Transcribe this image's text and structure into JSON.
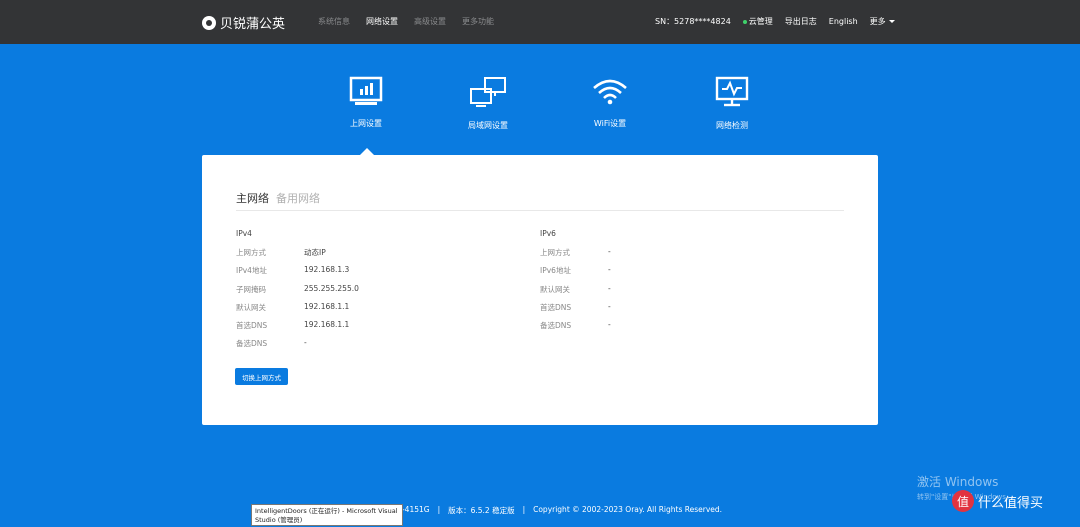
{
  "brand": {
    "name": "贝锐蒲公英"
  },
  "nav": {
    "items": [
      "系统信息",
      "网络设置",
      "高级设置",
      "更多功能"
    ],
    "active_index": 1
  },
  "header_right": {
    "sn": "SN：5278****4824",
    "cloud": "云管理",
    "export_log": "导出日志",
    "language": "English",
    "more": "更多"
  },
  "features": [
    {
      "label": "上网设置",
      "icon": "monitor-chart-icon"
    },
    {
      "label": "局域网设置",
      "icon": "network-computers-icon"
    },
    {
      "label": "WiFi设置",
      "icon": "wifi-icon"
    },
    {
      "label": "网络检测",
      "icon": "monitor-pulse-icon"
    }
  ],
  "tabs": {
    "main": "主网络",
    "backup": "备用网络"
  },
  "ipv4": {
    "title": "IPv4",
    "rows": [
      {
        "k": "上网方式",
        "v": "动态IP"
      },
      {
        "k": "IPv4地址",
        "v": "192.168.1.3"
      },
      {
        "k": "子网掩码",
        "v": "255.255.255.0"
      },
      {
        "k": "默认网关",
        "v": "192.168.1.1"
      },
      {
        "k": "首选DNS",
        "v": "192.168.1.1"
      },
      {
        "k": "备选DNS",
        "v": "-"
      }
    ]
  },
  "ipv6": {
    "title": "IPv6",
    "rows": [
      {
        "k": "上网方式",
        "v": "-"
      },
      {
        "k": "IPv6地址",
        "v": "-"
      },
      {
        "k": "默认网关",
        "v": "-"
      },
      {
        "k": "首选DNS",
        "v": "-"
      },
      {
        "k": "备选DNS",
        "v": "-"
      }
    ]
  },
  "switch_button": "切换上网方式",
  "footer": {
    "model": "A-4151G",
    "sep": "|",
    "version": "版本：6.5.2 稳定版",
    "copyright": "Copyright © 2002-2023 Oray. All Rights Reserved."
  },
  "tooltip": "IntelligentDoors (正在运行) - Microsoft Visual Studio (管理员)",
  "activate": {
    "title": "激活 Windows",
    "sub": "转到\"设置\"以激活 Windows。"
  },
  "watermark": {
    "badge": "值",
    "text": "什么值得买"
  },
  "colors": {
    "primary": "#0a7be0",
    "topbar": "#333436",
    "cloud_dot": "#3fd26b"
  }
}
